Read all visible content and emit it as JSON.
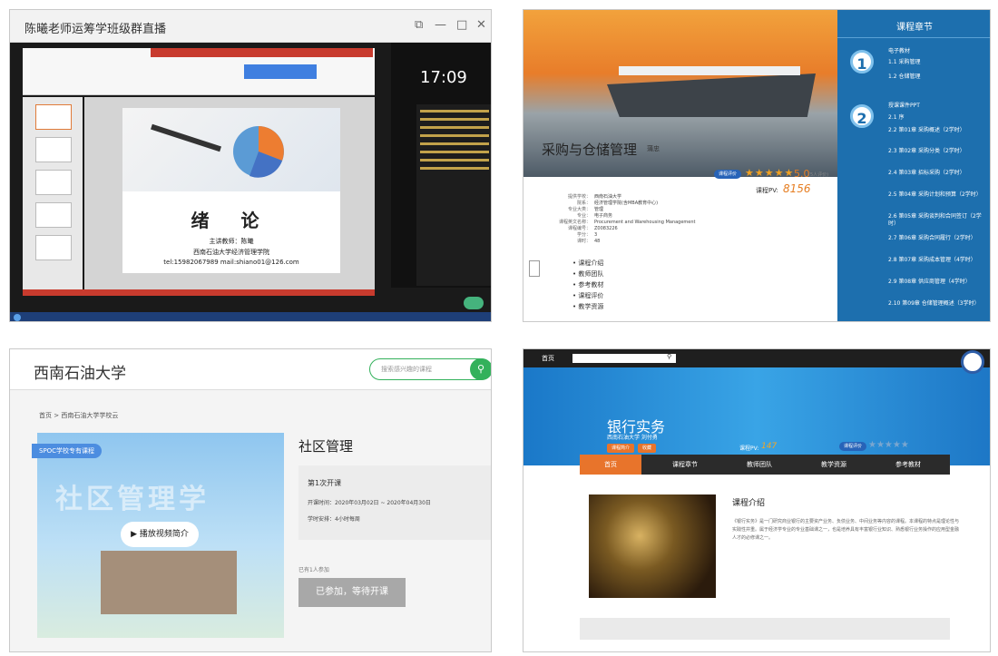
{
  "panel1": {
    "window_title": "陈曦老师运筹学班级群直播",
    "slide": {
      "title": "绪 论",
      "lecturer": "主讲教师：陈曦",
      "school": "西南石油大学经济管理学院",
      "contact": "tel:15982067989  mail:shiano01@126.com"
    },
    "clock": "17:09"
  },
  "panel2": {
    "course_title": "采购与仓储管理",
    "lecturer": "蒲忠",
    "rating_badge": "课程评价",
    "stars": "★★★★★",
    "score": "5.0",
    "score_note": "(5人评价)",
    "pv_label": "课程PV:",
    "pv": "8156",
    "info": [
      {
        "k": "提供学校：",
        "v": "西南石油大学"
      },
      {
        "k": "院系：",
        "v": "经济管理学院(含MBA教育中心)"
      },
      {
        "k": "专业大类：",
        "v": "管理"
      },
      {
        "k": "专业：",
        "v": "电子商务"
      },
      {
        "k": "课程英文名称：",
        "v": "Procurement and Warehousing Management"
      },
      {
        "k": "课程编号：",
        "v": "Z0083226"
      },
      {
        "k": "学分：",
        "v": "3"
      },
      {
        "k": "课时：",
        "v": "48"
      }
    ],
    "menu": [
      "课程介绍",
      "教师团队",
      "参考教材",
      "课程评价",
      "教学资源"
    ],
    "sidebar_title": "课程章节",
    "group1_title": "电子教材",
    "group1": [
      "1.1 采购管理",
      "1.2 仓储管理"
    ],
    "group2_title": "授课课件PPT",
    "group2": [
      "2.1 序",
      "2.2 第01章 采购概述（2学时）",
      "2.3 第02章 采购分类（2学时）",
      "2.4 第03章 招标采购（2学时）",
      "2.5 第04章 采购计划和预算（2学时）",
      "2.6 第05章 采购谈判和合同签订（2学时）",
      "2.7 第06章 采购合同履行（2学时）",
      "2.8 第07章 采购成本管理（4学时）",
      "2.9 第08章 供应商管理（4学时）",
      "2.10 第09章 仓储管理概述（3学时）"
    ]
  },
  "panel3": {
    "brand": "西南石油大学",
    "search_placeholder": "搜索感兴趣的课程",
    "breadcrumb": "首页 > 西南石油大学学校云",
    "spoc": "SPOC学校专有课程",
    "cover_title": "社区管理学",
    "play": "▶ 播放视频简介",
    "course_title": "社区管理",
    "term": "第1次开课",
    "dates": "开课时间：2020年03月02日 ~ 2020年04月30日",
    "hours": "学时安排：4小时每周",
    "joined": "已有1人参加",
    "enroll": "已参加，等待开课"
  },
  "panel4": {
    "home": "首页",
    "course_title": "银行实务",
    "subtitle": "西南石油大学  刘付勇",
    "tags": [
      "课程简介",
      "收藏"
    ],
    "pv_label": "课程PV:",
    "pv": "147",
    "eval": "课程评价",
    "stars": "★★★★★",
    "nav": [
      "首页",
      "课程章节",
      "教师团队",
      "教学资源",
      "参考教材"
    ],
    "intro_title": "课程介绍",
    "intro_text": "《银行实务》是一门研究商业银行的主要资产业务、负债业务、中间业务等内容的课程。本课程的特点是理论性与实践性并重。属于经济学专业的专业基础课之一，也是培养具有丰富银行业知识、熟悉银行业务操作的应用型金融人才的必修课之一。"
  }
}
